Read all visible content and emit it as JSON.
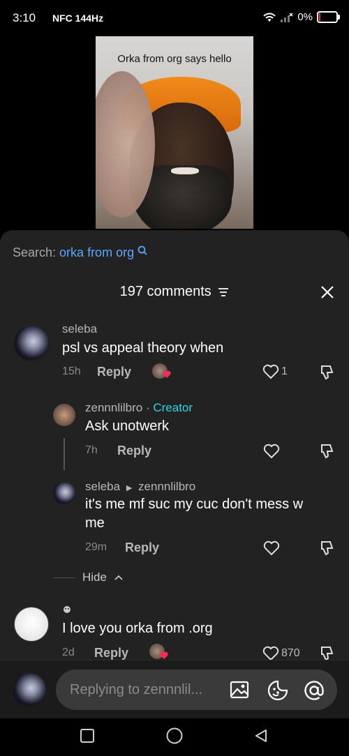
{
  "status_bar": {
    "time": "3:10",
    "extra": "NFC 144Hz",
    "battery": "0%"
  },
  "video": {
    "caption": "Orka from org says hello"
  },
  "search": {
    "prefix": "Search: ",
    "query": "orka from org"
  },
  "comments_header": {
    "title": "197 comments"
  },
  "comments": [
    {
      "username": "seleba",
      "text": "psl vs appeal theory when",
      "time": "15h",
      "reply_label": "Reply",
      "likes": "1"
    },
    {
      "username": "zennnlilbro",
      "badge": "· Creator",
      "text": "Ask unotwerk",
      "time": "7h",
      "reply_label": "Reply"
    },
    {
      "username": "seleba",
      "reply_to": "zennnlilbro",
      "text": "it's me mf suc my cuc don't mess w",
      "text2": "me",
      "time": "29m",
      "reply_label": "Reply"
    },
    {
      "text": "I love you orka from .org",
      "time": "2d",
      "reply_label": "Reply",
      "likes": "870"
    }
  ],
  "hide_label": "Hide",
  "composer": {
    "placeholder": "Replying to zennnlil..."
  },
  "colors": {
    "accent_link": "#5aa8ff",
    "creator": "#2fd6e8",
    "sheet_bg": "#222222",
    "heart": "#ff2b55"
  },
  "icons": [
    "search-icon",
    "sort-icon",
    "close-icon",
    "heart-icon",
    "dislike-icon",
    "image-icon",
    "emoji-icon",
    "mention-icon",
    "home-square-icon",
    "home-circle-icon",
    "back-triangle-icon"
  ]
}
